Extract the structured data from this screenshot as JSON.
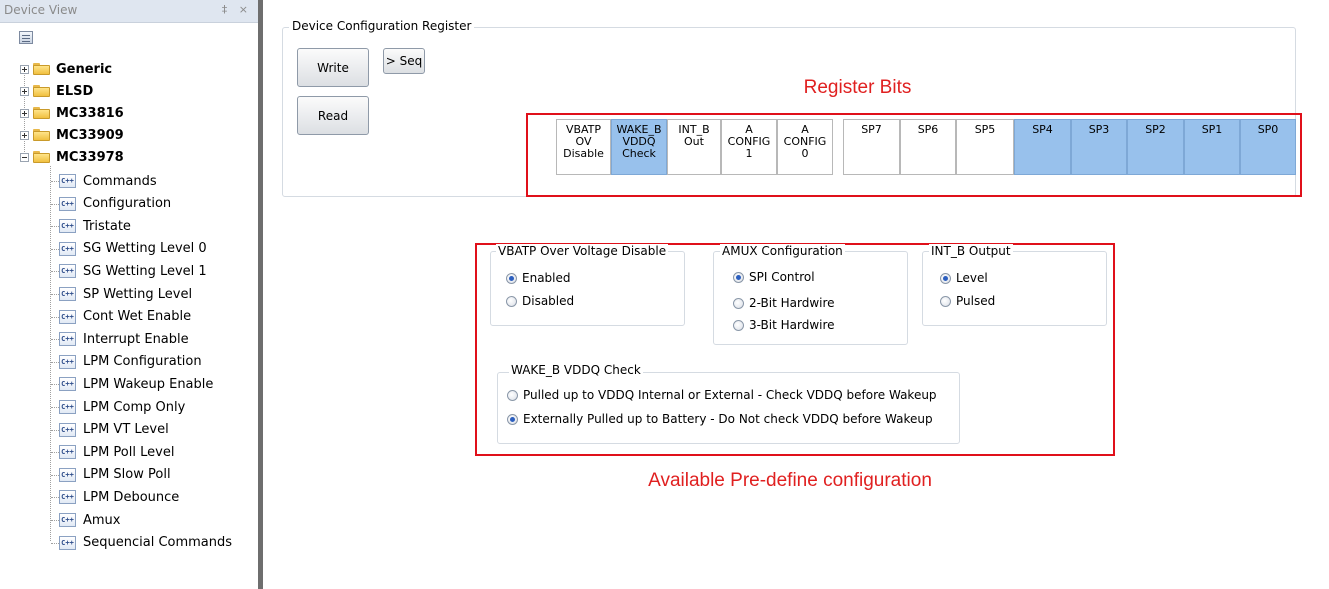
{
  "panel": {
    "title": "Device View",
    "controls": "‡ ×",
    "folders": [
      "Generic",
      "ELSD",
      "MC33816",
      "MC33909",
      "MC33978"
    ],
    "commands": [
      "Commands",
      "Configuration",
      "Tristate",
      "SG Wetting Level 0",
      "SG Wetting Level 1",
      "SP Wetting Level",
      "Cont Wet Enable",
      "Interrupt Enable",
      "LPM Configuration",
      "LPM Wakeup Enable",
      "LPM Comp Only",
      "LPM VT Level",
      "LPM Poll Level",
      "LPM Slow Poll",
      "LPM Debounce",
      "Amux",
      "Sequencial Commands"
    ],
    "command_icon_text": "C++"
  },
  "register": {
    "group_title": "Device Configuration Register",
    "write_label": "Write",
    "seq_label": "> Seq",
    "read_label": "Read",
    "bits_annotation": "Register Bits",
    "bits": [
      {
        "lines": [
          "VBATP",
          "OV",
          "Disable"
        ],
        "on": false
      },
      {
        "lines": [
          "WAKE_B",
          "VDDQ",
          "Check"
        ],
        "on": true
      },
      {
        "lines": [
          "INT_B",
          "Out",
          ""
        ],
        "on": false
      },
      {
        "lines": [
          "A",
          "CONFIG",
          "1"
        ],
        "on": false
      },
      {
        "lines": [
          "A",
          "CONFIG",
          "0"
        ],
        "on": false
      },
      {
        "lines": [
          "SP7",
          "",
          ""
        ],
        "on": false
      },
      {
        "lines": [
          "SP6",
          "",
          ""
        ],
        "on": false
      },
      {
        "lines": [
          "SP5",
          "",
          ""
        ],
        "on": false
      },
      {
        "lines": [
          "SP4",
          "",
          ""
        ],
        "on": true
      },
      {
        "lines": [
          "SP3",
          "",
          ""
        ],
        "on": true
      },
      {
        "lines": [
          "SP2",
          "",
          ""
        ],
        "on": true
      },
      {
        "lines": [
          "SP1",
          "",
          ""
        ],
        "on": true
      },
      {
        "lines": [
          "SP0",
          "",
          ""
        ],
        "on": true
      }
    ]
  },
  "config": {
    "vbatp": {
      "title": "VBATP Over Voltage Disable",
      "options": [
        "Enabled",
        "Disabled"
      ],
      "selected": "Enabled"
    },
    "amux": {
      "title": "AMUX Configuration",
      "options": [
        "SPI Control",
        "2-Bit Hardwire",
        "3-Bit Hardwire"
      ],
      "selected": "SPI Control"
    },
    "int_b": {
      "title": "INT_B Output",
      "options": [
        "Level",
        "Pulsed"
      ],
      "selected": "Level"
    },
    "wake_b": {
      "title": "WAKE_B VDDQ Check",
      "options": [
        "Pulled up to VDDQ Internal or External - Check VDDQ before Wakeup",
        "Externally Pulled up to Battery - Do Not check VDDQ before Wakeup"
      ],
      "selected": "Externally Pulled up to Battery - Do Not check VDDQ before Wakeup"
    },
    "annotation": "Available Pre-define configuration"
  },
  "colors": {
    "bit_on": "#98c1ec",
    "annotation_red": "#e0101a"
  }
}
